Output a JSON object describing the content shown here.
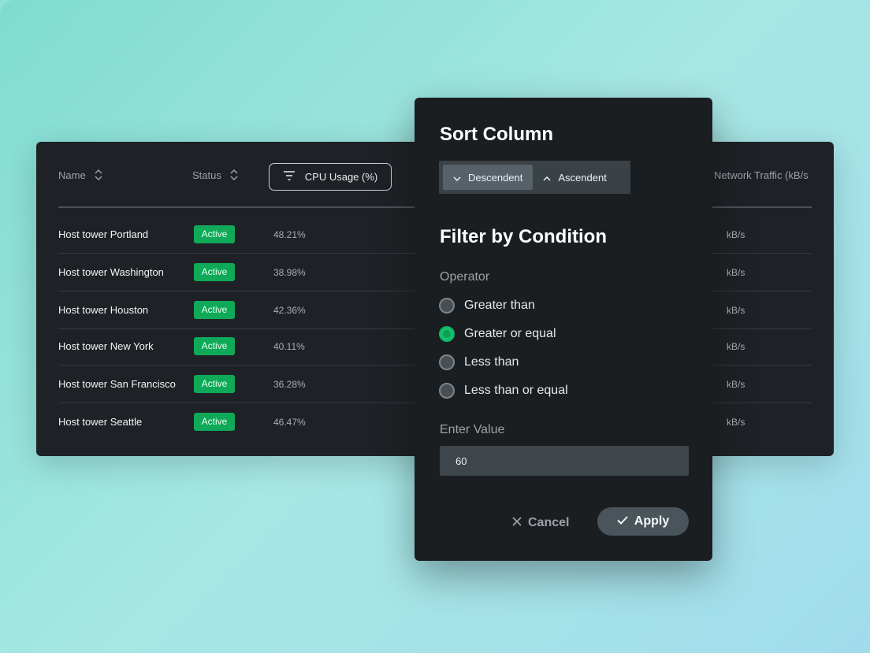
{
  "table": {
    "columns": {
      "name": "Name",
      "status": "Status",
      "cpu": "CPU Usage (%)",
      "network": "Network Traffic (kB/s"
    },
    "rows": [
      {
        "name": "Host tower Portland",
        "status": "Active",
        "cpu": "48.21%",
        "net": "kB/s"
      },
      {
        "name": "Host tower Washington",
        "status": "Active",
        "cpu": "38.98%",
        "net": "kB/s"
      },
      {
        "name": "Host tower Houston",
        "status": "Active",
        "cpu": "42.36%",
        "net": "kB/s"
      },
      {
        "name": "Host tower New York",
        "status": "Active",
        "cpu": "40.11%",
        "net": "kB/s"
      },
      {
        "name": "Host tower San Francisco",
        "status": "Active",
        "cpu": "36.28%",
        "net": "kB/s"
      },
      {
        "name": "Host tower Seattle",
        "status": "Active",
        "cpu": "46.47%",
        "net": "kB/s"
      }
    ]
  },
  "popover": {
    "sort_title": "Sort Column",
    "sort_descending": "Descendent",
    "sort_ascending": "Ascendent",
    "filter_title": "Filter by Condition",
    "operator_label": "Operator",
    "operators": [
      {
        "label": "Greater than",
        "selected": false
      },
      {
        "label": "Greater or equal",
        "selected": true
      },
      {
        "label": "Less than",
        "selected": false
      },
      {
        "label": "Less than or equal",
        "selected": false
      }
    ],
    "value_label": "Enter Value",
    "value": "60",
    "cancel_label": "Cancel",
    "apply_label": "Apply"
  },
  "colors": {
    "active_badge": "#0fa958",
    "radio_selected": "#14c46c",
    "card_bg": "#1e2226",
    "popover_bg": "#1b1e21"
  }
}
